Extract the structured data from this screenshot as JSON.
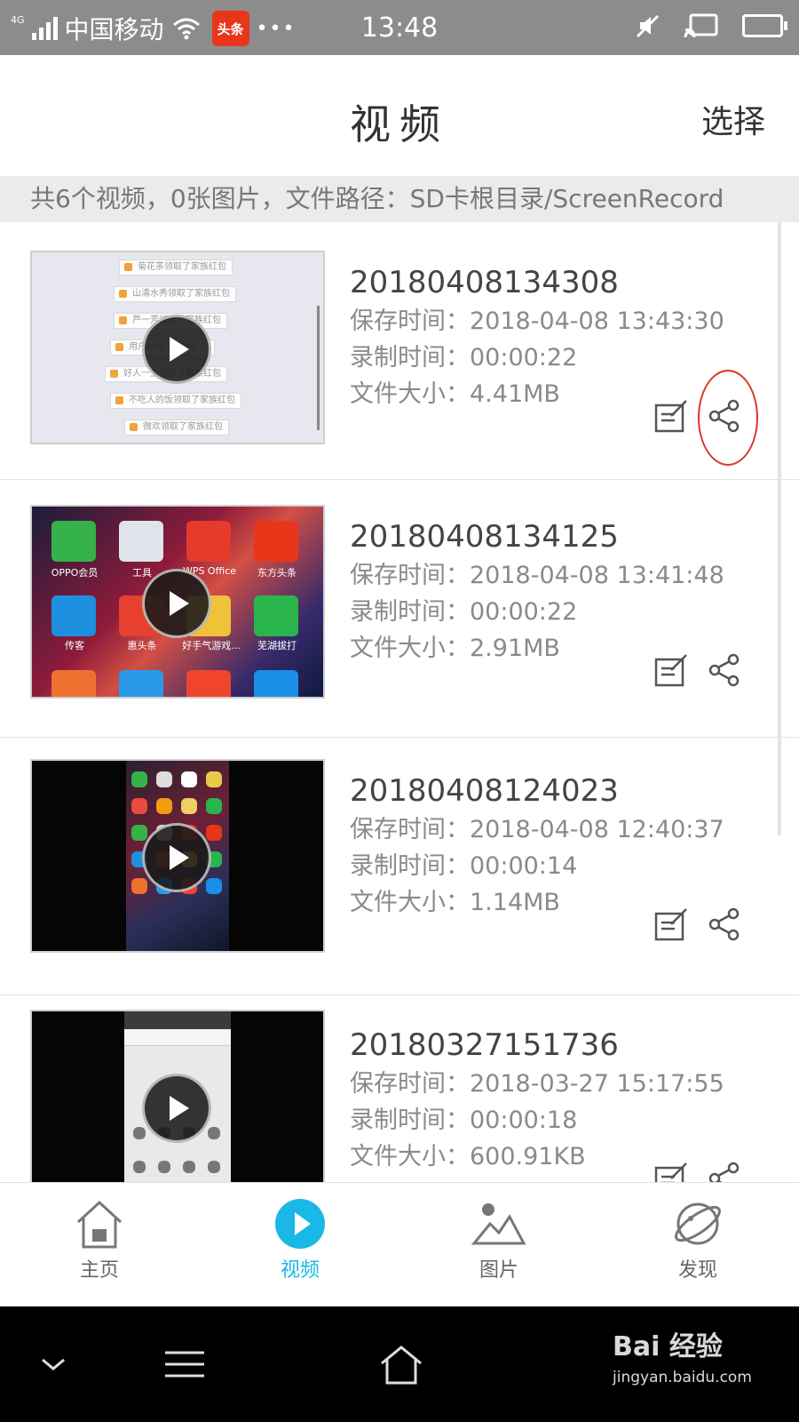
{
  "status_bar": {
    "network_type": "4G",
    "carrier": "中国移动",
    "app_badge": "头条",
    "time": "13:48"
  },
  "header": {
    "title": "视频",
    "select_label": "选择"
  },
  "info_bar": {
    "text": "共6个视频，0张图片，文件路径：SD卡根目录/ScreenRecord"
  },
  "thumbnail_texts": {
    "chat_lines": [
      "菊花茶领取了家族红包",
      "山清水秀领取了家族红包",
      "芦一芳领取了家族红包",
      "用户领取了家族红包",
      "好人一生领取了家族红包",
      "不吃人的饭领取了家族红包",
      "微欢领取了家族红包"
    ],
    "home_apps": [
      "OPPO会员",
      "工具",
      "WPS Office",
      "东方头条",
      "传客",
      "惠头条",
      "好手气游戏...",
      "芜湖拔打"
    ]
  },
  "videos": [
    {
      "name": "20180408134308",
      "saved": "保存时间：2018-04-08 13:43:30",
      "duration": "录制时间：00:00:22",
      "size": "文件大小：4.41MB"
    },
    {
      "name": "20180408134125",
      "saved": "保存时间：2018-04-08 13:41:48",
      "duration": "录制时间：00:00:22",
      "size": "文件大小：2.91MB"
    },
    {
      "name": "20180408124023",
      "saved": "保存时间：2018-04-08 12:40:37",
      "duration": "录制时间：00:00:14",
      "size": "文件大小：1.14MB"
    },
    {
      "name": "20180327151736",
      "saved": "保存时间：2018-03-27 15:17:55",
      "duration": "录制时间：00:00:18",
      "size": "文件大小：600.91KB"
    }
  ],
  "tabs": [
    {
      "label": "主页",
      "icon": "home-icon"
    },
    {
      "label": "视频",
      "icon": "play-circle-icon",
      "active": true
    },
    {
      "label": "图片",
      "icon": "image-icon"
    },
    {
      "label": "发现",
      "icon": "planet-icon"
    }
  ],
  "watermark": {
    "logo": "Bai 经验",
    "url": "jingyan.baidu.com"
  },
  "colors": {
    "accent": "#19b8e6",
    "highlight_circle": "#d9392b",
    "status_bar": "#8c8c8c"
  }
}
